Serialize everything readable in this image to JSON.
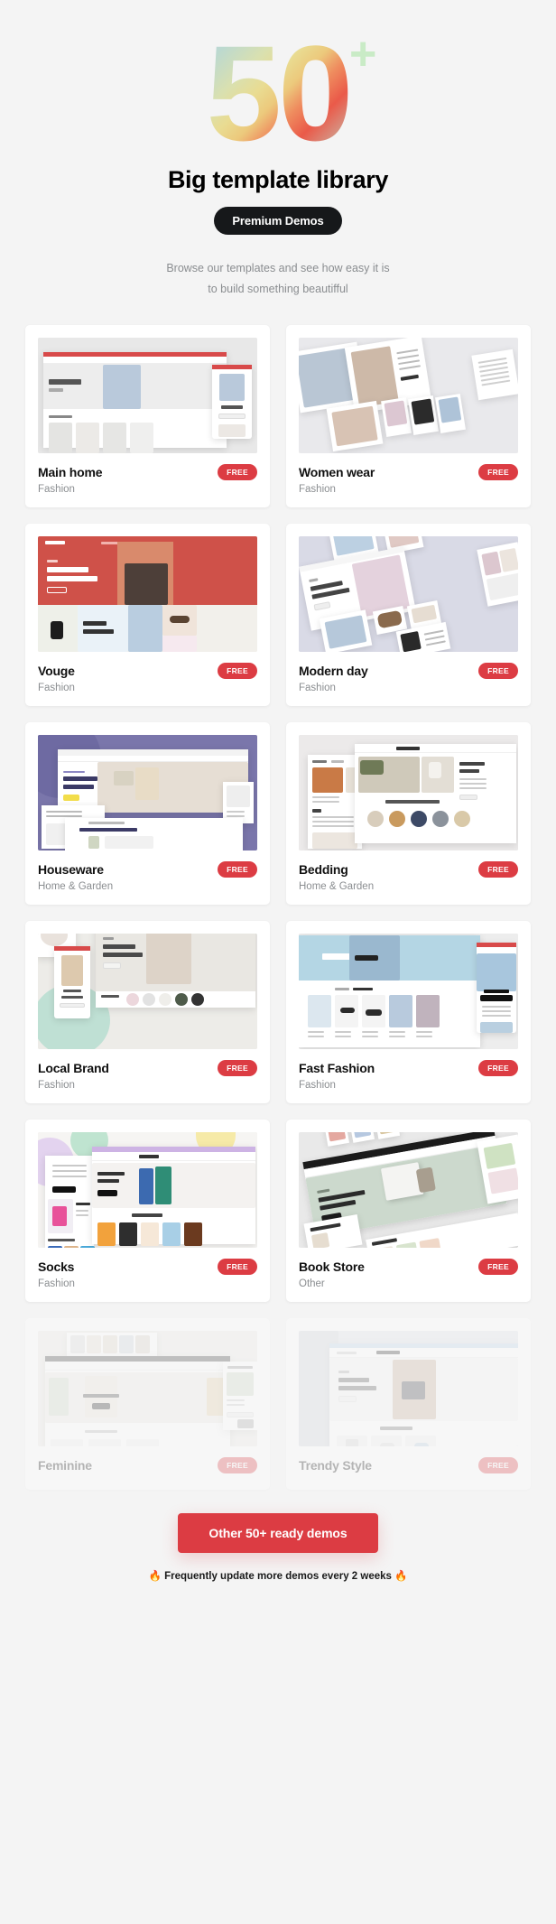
{
  "hero": {
    "number": "50",
    "plus": "+",
    "title": "Big template library",
    "badge": "Premium Demos",
    "desc_line1": "Browse our templates and see how easy it is",
    "desc_line2": "to build something beautifful"
  },
  "colors": {
    "accent_red": "#dc3c43",
    "badge_black": "#16181a",
    "page_bg": "#f4f4f4",
    "plus_green": "#c9ebc6",
    "muted_text": "#8a8d90"
  },
  "cards": [
    {
      "title": "Main home",
      "category": "Fashion",
      "badge": "FREE",
      "faded": false,
      "art": "mainhome"
    },
    {
      "title": "Women wear",
      "category": "Fashion",
      "badge": "FREE",
      "faded": false,
      "art": "womenwear"
    },
    {
      "title": "Vouge",
      "category": "Fashion",
      "badge": "FREE",
      "faded": false,
      "art": "vouge"
    },
    {
      "title": "Modern day",
      "category": "Fashion",
      "badge": "FREE",
      "faded": false,
      "art": "modernday"
    },
    {
      "title": "Houseware",
      "category": "Home & Garden",
      "badge": "FREE",
      "faded": false,
      "art": "houseware"
    },
    {
      "title": "Bedding",
      "category": "Home & Garden",
      "badge": "FREE",
      "faded": false,
      "art": "bedding"
    },
    {
      "title": "Local Brand",
      "category": "Fashion",
      "badge": "FREE",
      "faded": false,
      "art": "localbrand"
    },
    {
      "title": "Fast Fashion",
      "category": "Fashion",
      "badge": "FREE",
      "faded": false,
      "art": "fastfashion"
    },
    {
      "title": "Socks",
      "category": "Fashion",
      "badge": "FREE",
      "faded": false,
      "art": "socks"
    },
    {
      "title": "Book Store",
      "category": "Other",
      "badge": "FREE",
      "faded": false,
      "art": "bookstore"
    },
    {
      "title": "Feminine",
      "category": "",
      "badge": "FREE",
      "faded": true,
      "art": "feminine"
    },
    {
      "title": "Trendy Style",
      "category": "",
      "badge": "FREE",
      "faded": true,
      "art": "trendy"
    }
  ],
  "footer": {
    "cta_label": "Other 50+ ready demos",
    "note": "🔥 Frequently update more demos every 2 weeks 🔥"
  }
}
